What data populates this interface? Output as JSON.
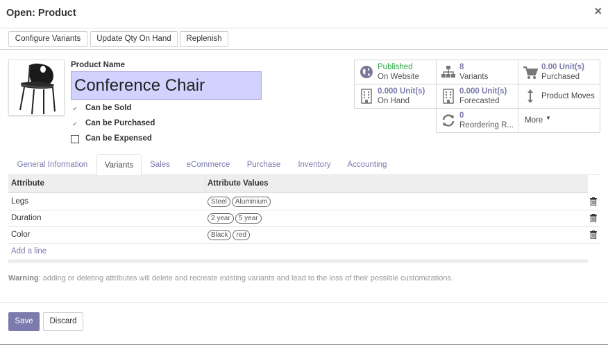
{
  "dialog": {
    "title": "Open: Product",
    "close": "×"
  },
  "toolbar": {
    "configure_variants": "Configure Variants",
    "update_qty": "Update Qty On Hand",
    "replenish": "Replenish"
  },
  "product": {
    "name_label": "Product Name",
    "name_value": "Conference Chair",
    "checkboxes": [
      {
        "label": "Can be Sold",
        "checked": true
      },
      {
        "label": "Can be Purchased",
        "checked": true
      },
      {
        "label": "Can be Expensed",
        "checked": false
      }
    ]
  },
  "stats": {
    "published": {
      "line1": "Published",
      "line2": "On Website",
      "icon": "globe-icon"
    },
    "variants": {
      "line1": "8",
      "line2": "Variants",
      "icon": "sitemap-icon"
    },
    "purchased": {
      "line1": "0.00 Unit(s)",
      "line2": "Purchased",
      "icon": "cart-icon"
    },
    "on_hand": {
      "line1": "0.000 Unit(s)",
      "line2": "On Hand",
      "icon": "building-icon"
    },
    "forecasted": {
      "line1": "0.000 Unit(s)",
      "line2": "Forecasted",
      "icon": "building-icon"
    },
    "moves": {
      "label": "Product Moves",
      "icon": "updown-arrows-icon"
    },
    "reordering": {
      "line1": "0",
      "line2": "Reordering R...",
      "icon": "refresh-icon"
    },
    "more": {
      "label": "More"
    }
  },
  "tabs": [
    "General Information",
    "Variants",
    "Sales",
    "eCommerce",
    "Purchase",
    "Inventory",
    "Accounting"
  ],
  "active_tab": "Variants",
  "table": {
    "headers": [
      "Attribute",
      "Attribute Values"
    ],
    "rows": [
      {
        "attribute": "Legs",
        "values": [
          "Steel",
          "Aluminium"
        ]
      },
      {
        "attribute": "Duration",
        "values": [
          "2 year",
          "5 year"
        ]
      },
      {
        "attribute": "Color",
        "values": [
          "Black",
          "red"
        ]
      }
    ],
    "add_line": "Add a line"
  },
  "warning": {
    "label": "Warning",
    "text": ": adding or deleting attributes will delete and recreate existing variants and lead to the loss of their possible customizations."
  },
  "footer": {
    "save": "Save",
    "discard": "Discard"
  },
  "colors": {
    "primary": "#7c7bad",
    "published": "#28a745",
    "name_field_bg": "#d2d2ff"
  }
}
